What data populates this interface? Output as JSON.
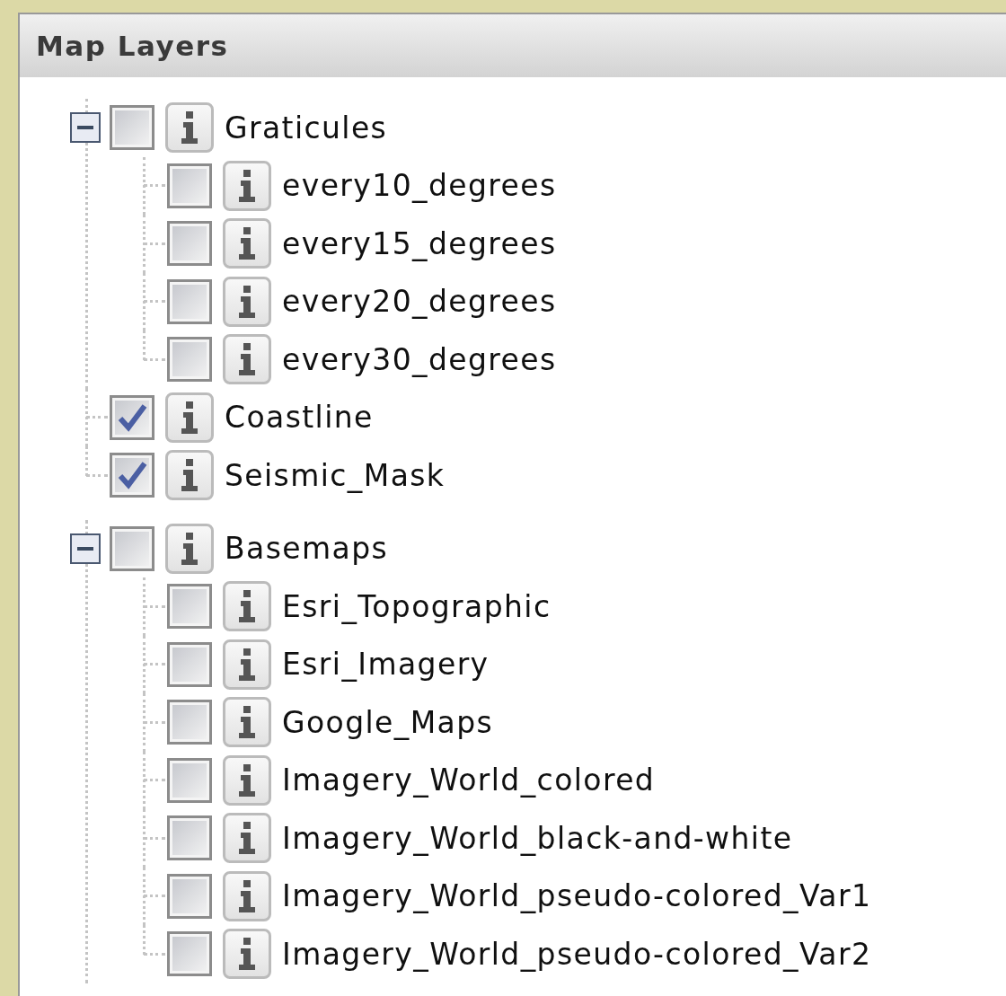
{
  "panel": {
    "title": "Map Layers"
  },
  "trees": [
    {
      "items": [
        {
          "label": "Graticules",
          "checked": false,
          "expanded": true,
          "children": [
            {
              "label": "every10_degrees",
              "checked": false
            },
            {
              "label": "every15_degrees",
              "checked": false
            },
            {
              "label": "every20_degrees",
              "checked": false
            },
            {
              "label": "every30_degrees",
              "checked": false
            }
          ]
        },
        {
          "label": "Coastline",
          "checked": true
        },
        {
          "label": "Seismic_Mask",
          "checked": true
        }
      ]
    },
    {
      "items": [
        {
          "label": "Basemaps",
          "checked": false,
          "expanded": true,
          "children": [
            {
              "label": "Esri_Topographic",
              "checked": false
            },
            {
              "label": "Esri_Imagery",
              "checked": false
            },
            {
              "label": "Google_Maps",
              "checked": false
            },
            {
              "label": "Imagery_World_colored",
              "checked": false
            },
            {
              "label": "Imagery_World_black-and-white",
              "checked": false
            },
            {
              "label": "Imagery_World_pseudo-colored_Var1",
              "checked": false
            },
            {
              "label": "Imagery_World_pseudo-colored_Var2",
              "checked": false
            }
          ]
        }
      ]
    }
  ]
}
